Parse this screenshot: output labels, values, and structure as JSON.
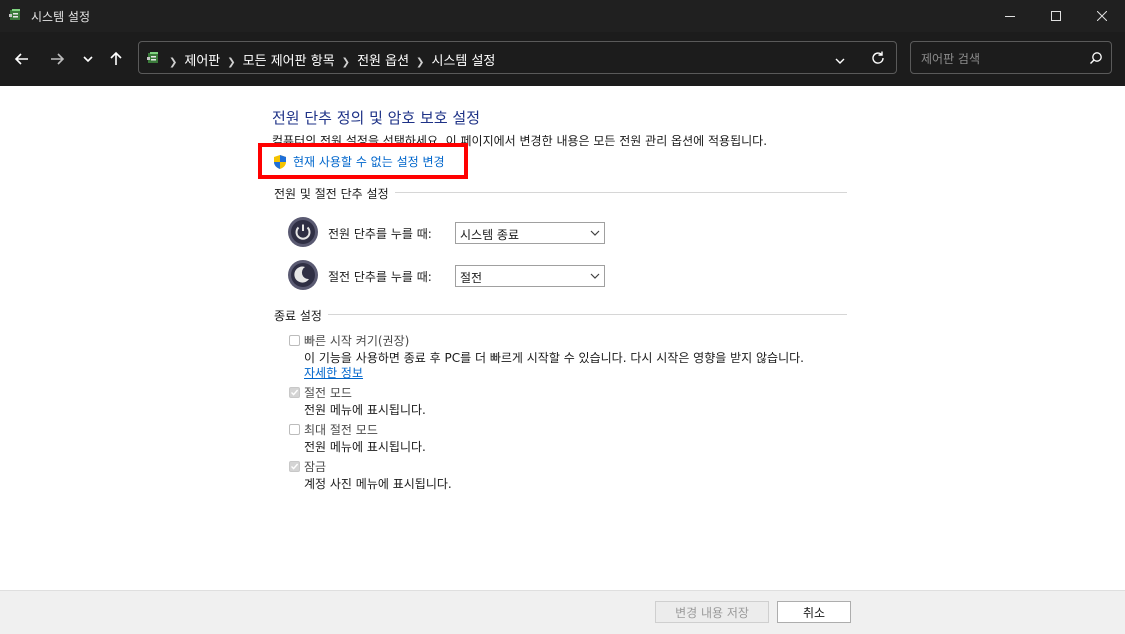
{
  "window": {
    "title": "시스템 설정",
    "controls": [
      "minimize-icon",
      "maximize-icon",
      "close-icon"
    ]
  },
  "nav": {
    "breadcrumbs": [
      "제어판",
      "모든 제어판 항목",
      "전원 옵션",
      "시스템 설정"
    ],
    "search_placeholder": "제어판 검색"
  },
  "content": {
    "title": "전원 단추 정의 및 암호 보호 설정",
    "description": "컴퓨터의 전원 설정을 선택하세요. 이 페이지에서 변경한 내용은 모든 전원 관리 옵션에 적용됩니다.",
    "change_link": "현재 사용할 수 없는 설정 변경",
    "power_group": {
      "heading": "전원 및 절전 단추 설정",
      "rows": [
        {
          "label": "전원 단추를 누를 때:",
          "value": "시스템 종료"
        },
        {
          "label": "절전 단추를 누를 때:",
          "value": "절전"
        }
      ]
    },
    "shutdown_group": {
      "heading": "종료 설정",
      "options": [
        {
          "label": "빠른 시작 켜기(권장)",
          "checked": false,
          "desc": "이 기능을 사용하면 종료 후 PC를 더 빠르게 시작할 수 있습니다. 다시 시작은 영향을 받지 않습니다.",
          "more": "자세한 정보"
        },
        {
          "label": "절전 모드",
          "checked": true,
          "desc": "전원 메뉴에 표시됩니다."
        },
        {
          "label": "최대 절전 모드",
          "checked": false,
          "desc": "전원 메뉴에 표시됩니다."
        },
        {
          "label": "잠금",
          "checked": true,
          "desc": "계정 사진 메뉴에 표시됩니다."
        }
      ]
    }
  },
  "footer": {
    "save_label": "변경 내용 저장",
    "cancel_label": "취소"
  },
  "colors": {
    "title_blue": "#1e3287",
    "link_blue": "#0066cc",
    "highlight_red": "#ff0000",
    "titlebar_bg": "#202020"
  }
}
